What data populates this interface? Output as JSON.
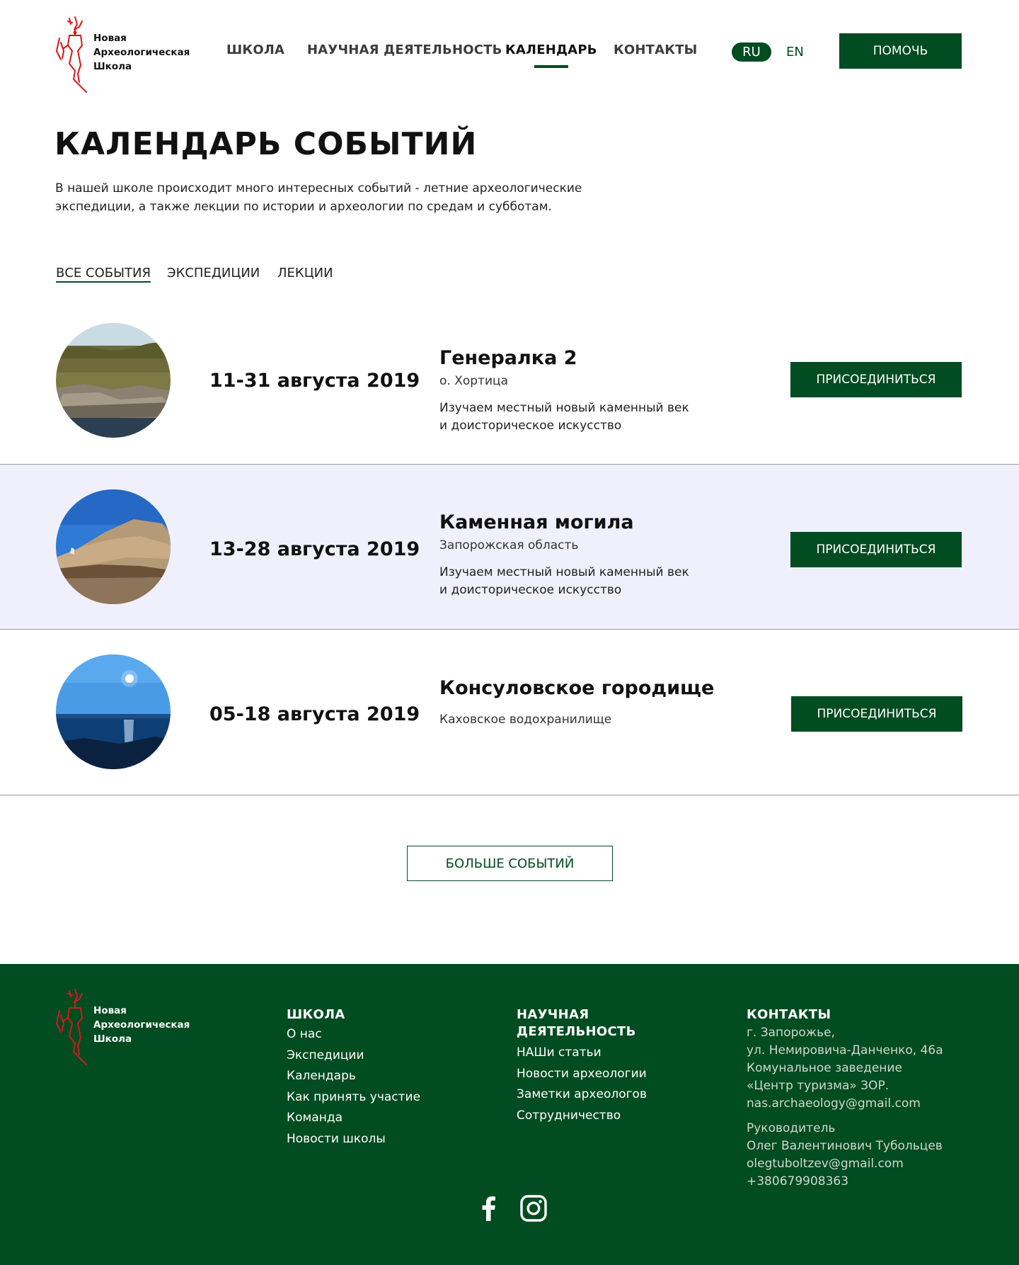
{
  "logo": {
    "line1": "Новая",
    "line2": "Археологическая",
    "line3": "Школа"
  },
  "nav": {
    "items": [
      {
        "label": "ШКОЛА"
      },
      {
        "label": "НАУЧНАЯ ДЕЯТЕЛЬНОСТЬ"
      },
      {
        "label": "КАЛЕНДАРЬ"
      },
      {
        "label": "КОНТАКТЫ"
      }
    ],
    "active": "КАЛЕНДАРЬ"
  },
  "lang": {
    "ru": "RU",
    "en": "EN",
    "active": "RU"
  },
  "help_button": "ПОМОЧЬ",
  "page": {
    "title": "КАЛЕНДАРЬ СОБЫТИЙ",
    "intro_line1": "В нашей школе происходит много интересных событий - летние археологические",
    "intro_line2": "экспедиции, а также лекции по истории и археологии по средам и субботам."
  },
  "tabs": {
    "items": [
      {
        "label": "ВСЕ СОБЫТИЯ"
      },
      {
        "label": "ЭКСПЕДИЦИИ"
      },
      {
        "label": "ЛЕКЦИИ"
      }
    ],
    "active": "ВСЕ СОБЫТИЯ"
  },
  "events": [
    {
      "date": "11-31 августа 2019",
      "title": "Генералка 2",
      "place": "о. Хортица",
      "desc_line1": "Изучаем местный новый каменный век",
      "desc_line2": "и доисторическое искусство",
      "button": "ПРИСОЕДИНИТЬСЯ"
    },
    {
      "date": "13-28 августа 2019",
      "title": "Каменная могила",
      "place": "Запорожская область",
      "desc_line1": "Изучаем местный новый каменный век",
      "desc_line2": "и доисторическое искусство",
      "button": "ПРИСОЕДИНИТЬСЯ"
    },
    {
      "date": "05-18 августа 2019",
      "title": "Консуловское городище",
      "place": "Каховское водохранилище",
      "desc_line1": "",
      "desc_line2": "",
      "button": "ПРИСОЕДИНИТЬСЯ"
    }
  ],
  "more_button": "БОЛЬШЕ СОБЫТИЙ",
  "footer": {
    "school": {
      "heading": "ШКОЛА",
      "links": [
        "О нас",
        "Экспедиции",
        "Календарь",
        "Как принять участие",
        "Команда",
        "Новости школы"
      ]
    },
    "science": {
      "heading_line1": "НАУЧНАЯ",
      "heading_line2": "ДЕЯТЕЛЬНОСТЬ",
      "links": [
        "НАШи статьи",
        "Новости археологии",
        "Заметки археологов",
        "Сотрудничество"
      ]
    },
    "contacts": {
      "heading": "КОНТАКТЫ",
      "address": [
        "г. Запорожье,",
        "ул. Немировича-Данченко, 46а",
        "Комунальное заведение",
        "«Центр туризма» ЗОР.",
        "nas.archaeology@gmail.com"
      ],
      "head_person": [
        "Руководитель",
        "Олег Валентинович Тубольцев",
        "olegtuboltzev@gmail.com",
        "+380679908363"
      ]
    }
  },
  "social": {
    "facebook": "facebook-icon",
    "instagram": "instagram-icon"
  },
  "colors": {
    "brand_green": "#024c21",
    "alt_row": "#f0f0fc",
    "logo_red": "#d8161b"
  }
}
